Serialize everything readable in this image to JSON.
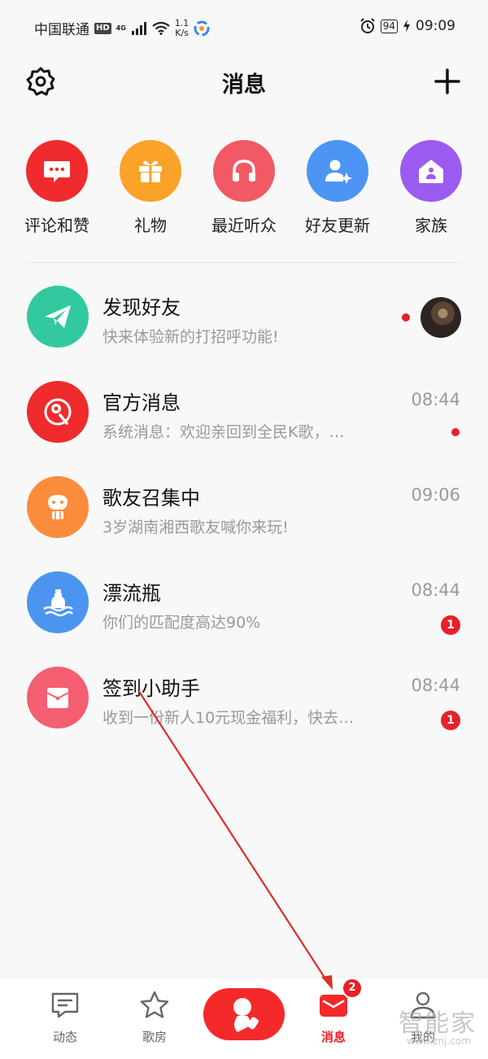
{
  "status_bar": {
    "carrier": "中国联通",
    "hd": "HD",
    "network": "4G",
    "speed_value": "1.1",
    "speed_unit": "K/s",
    "battery": "94",
    "time": "09:09"
  },
  "header": {
    "title": "消息",
    "settings_icon": "gear-icon",
    "add_icon": "plus-icon"
  },
  "quick_entries": [
    {
      "label": "评论和赞",
      "icon": "comment-icon",
      "color": "#ef2b2d"
    },
    {
      "label": "礼物",
      "icon": "gift-icon",
      "color": "#fba228"
    },
    {
      "label": "最近听众",
      "icon": "headphones-icon",
      "color": "#f15a64"
    },
    {
      "label": "好友更新",
      "icon": "user-sparkle-icon",
      "color": "#4d95f4"
    },
    {
      "label": "家族",
      "icon": "home-icon",
      "color": "#9b5bf0"
    }
  ],
  "messages": [
    {
      "title": "发现好友",
      "subtitle": "快来体验新的打招呼功能!",
      "time": "",
      "badge": "",
      "unread_dot": true,
      "avatar_color": "#33c9a0",
      "icon": "paper-plane-icon"
    },
    {
      "title": "官方消息",
      "subtitle": "系统消息：欢迎亲回到全民K歌，…",
      "time": "08:44",
      "badge": "",
      "unread_dot": true,
      "avatar_color": "#ef2b2d",
      "icon": "official-logo-icon"
    },
    {
      "title": "歌友召集中",
      "subtitle": "3岁湖南湘西歌友喊你来玩!",
      "time": "09:06",
      "badge": "",
      "unread_dot": false,
      "avatar_color": "#fb8c3c",
      "icon": "balloon-icon"
    },
    {
      "title": "漂流瓶",
      "subtitle": "你们的匹配度高达90%",
      "time": "08:44",
      "badge": "1",
      "unread_dot": false,
      "avatar_color": "#4b95f0",
      "icon": "bottle-icon"
    },
    {
      "title": "签到小助手",
      "subtitle": "收到一份新人10元现金福利，快去…",
      "time": "08:44",
      "badge": "1",
      "unread_dot": false,
      "avatar_color": "#f35f70",
      "icon": "envelope-icon"
    }
  ],
  "bottom_nav": {
    "items": [
      {
        "label": "动态",
        "icon": "feed-icon",
        "active": false
      },
      {
        "label": "歌房",
        "icon": "star-icon",
        "active": false
      },
      {
        "label": "",
        "icon": "sing-icon",
        "active": false
      },
      {
        "label": "消息",
        "icon": "message-icon",
        "active": true
      },
      {
        "label": "我的",
        "icon": "profile-icon",
        "active": false
      }
    ],
    "message_badge": "2"
  },
  "watermark": {
    "main": "智能家",
    "url": "www.znj.com"
  },
  "colors": {
    "accent": "#e8202a",
    "background": "#f8f8f8"
  }
}
